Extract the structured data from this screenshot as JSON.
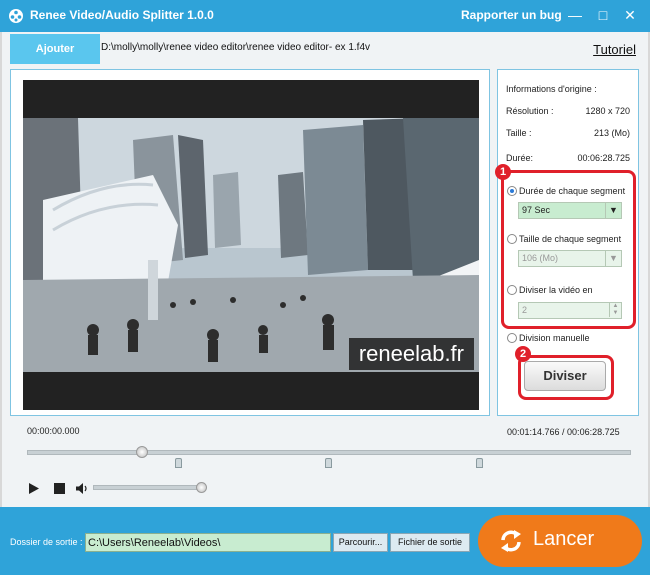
{
  "window": {
    "title": "Renee Video/Audio Splitter 1.0.0",
    "bug_link": "Rapporter un bug",
    "controls": {
      "minimize": "—",
      "maximize": "□",
      "close": "✕"
    }
  },
  "toolbar": {
    "add_label": "Ajouter",
    "file_path": "D:\\molly\\molly\\renee video editor\\renee video editor- ex 1.f4v",
    "tutorial_label": "Tutoriel"
  },
  "video": {
    "watermark": "reneelab.fr"
  },
  "info": {
    "heading": "Informations d'origine :",
    "resolution_label": "Résolution :",
    "resolution_value": "1280 x 720",
    "size_label": "Taille :",
    "size_value": "213 (Mo)",
    "duration_label": "Durée:",
    "duration_value": "00:06:28.725"
  },
  "split_options": {
    "badge1": "1",
    "badge2": "2",
    "segment_duration_label": "Durée de chaque segment",
    "segment_duration_value": "97 Sec",
    "segment_size_label": "Taille de chaque segment",
    "segment_size_value": "106 (Mo)",
    "divide_label": "Diviser la vidéo en",
    "divide_value": "2",
    "manual_label": "Division manuelle",
    "split_button": "Diviser",
    "selected": "segment_duration"
  },
  "timeline": {
    "current_time": "00:00:00.000",
    "range_time": "00:01:14.766 / 00:06:28.725",
    "playhead_fraction": 0.19,
    "volume_fraction": 0.98
  },
  "output": {
    "label": "Dossier de sortie :",
    "path": "C:\\Users\\Reneelab\\Videos\\",
    "browse_label": "Parcourir...",
    "output_file_label": "Fichier de sortie",
    "launch_label": "Lancer"
  },
  "colors": {
    "brand_blue": "#2fa3d9",
    "accent_orange": "#f07a1a",
    "highlight_red": "#e0202a",
    "field_green": "#c8ecd0"
  }
}
